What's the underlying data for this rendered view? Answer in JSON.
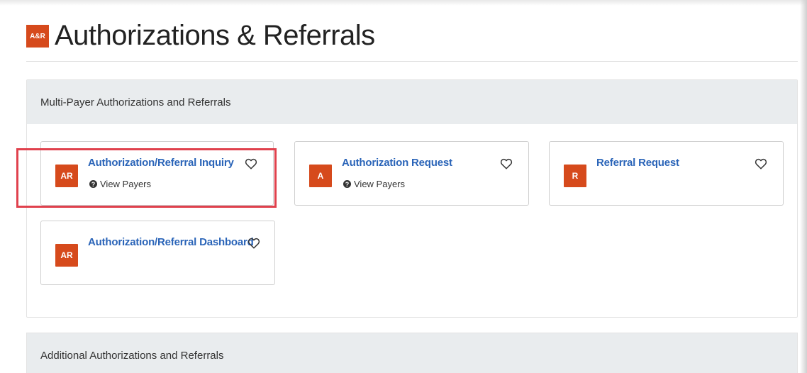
{
  "header": {
    "logo_text": "A&R",
    "title": "Authorizations & Referrals"
  },
  "sections": [
    {
      "title": "Multi-Payer Authorizations and Referrals",
      "tiles": [
        {
          "badge": "AR",
          "title": "Authorization/Referral Inquiry",
          "payers_label": "View Payers",
          "highlighted": true
        },
        {
          "badge": "A",
          "title": "Authorization Request",
          "payers_label": "View Payers"
        },
        {
          "badge": "R",
          "title": "Referral Request"
        },
        {
          "badge": "AR",
          "title": "Authorization/Referral Dashboard"
        }
      ]
    },
    {
      "title": "Additional Authorizations and Referrals"
    }
  ],
  "icons": {
    "favorite": "heart-outline-icon",
    "help": "question-circle-icon"
  },
  "colors": {
    "brand": "#d64a1c",
    "link": "#2a64b8",
    "highlight": "#e0414d",
    "panel_header_bg": "#e9ecee"
  }
}
